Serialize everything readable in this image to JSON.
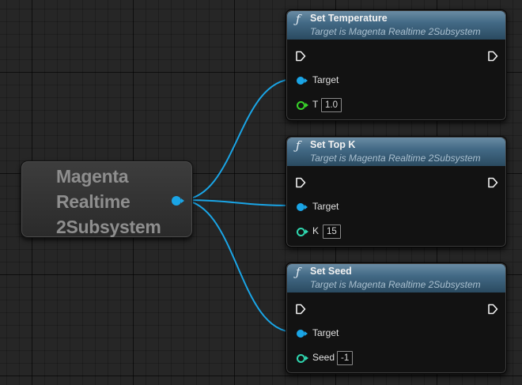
{
  "reference_node": {
    "title": "Magenta\nRealtime\n2Subsystem"
  },
  "function_icon": "ƒ",
  "nodes": [
    {
      "title": "Set Temperature",
      "subtitle": "Target is Magenta Realtime 2Subsystem",
      "target_label": "Target",
      "param_label": "T",
      "param_value": "1.0",
      "param_type": "float"
    },
    {
      "title": "Set Top K",
      "subtitle": "Target is Magenta Realtime 2Subsystem",
      "target_label": "Target",
      "param_label": "K",
      "param_value": "15",
      "param_type": "int"
    },
    {
      "title": "Set Seed",
      "subtitle": "Target is Magenta Realtime 2Subsystem",
      "target_label": "Target",
      "param_label": "Seed",
      "param_value": "-1",
      "param_type": "int"
    }
  ],
  "colors": {
    "wire": "#1aa5e6",
    "float_pin": "#38d42a",
    "int_pin": "#2fd8b0",
    "header_blue": "#436a86"
  }
}
